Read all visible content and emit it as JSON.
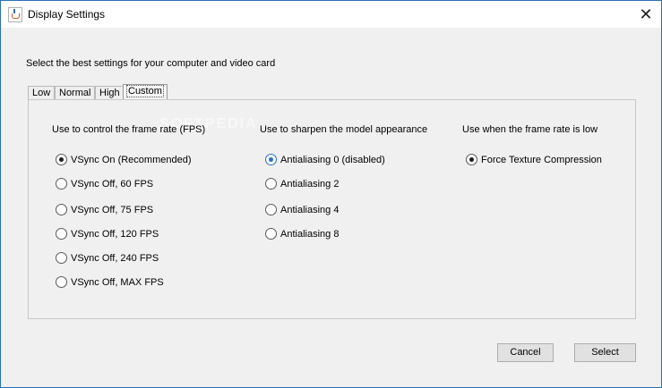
{
  "window": {
    "title": "Display Settings",
    "close_glyph": "✕"
  },
  "prompt": "Select the best settings for your computer and video card",
  "tabs": [
    {
      "label": "Low"
    },
    {
      "label": "Normal"
    },
    {
      "label": "High"
    },
    {
      "label": "Custom"
    }
  ],
  "watermark": "SOFTPEDIA",
  "columns": [
    {
      "header": "Use to control the frame rate (FPS)",
      "options": [
        {
          "label": "VSync On (Recommended)",
          "selected": true
        },
        {
          "label": "VSync Off, 60 FPS",
          "selected": false
        },
        {
          "label": "VSync Off, 75 FPS",
          "selected": false
        },
        {
          "label": "VSync Off, 120 FPS",
          "selected": false
        },
        {
          "label": "VSync Off, 240 FPS",
          "selected": false
        },
        {
          "label": "VSync Off, MAX FPS",
          "selected": false
        }
      ]
    },
    {
      "header": "Use to sharpen the model appearance",
      "options": [
        {
          "label": "Antialiasing 0 (disabled)",
          "selected": true
        },
        {
          "label": "Antialiasing 2",
          "selected": false
        },
        {
          "label": "Antialiasing 4",
          "selected": false
        },
        {
          "label": "Antialiasing 8",
          "selected": false
        }
      ]
    },
    {
      "header": "Use when the frame rate is low",
      "options": [
        {
          "label": "Force Texture Compression",
          "selected": true
        }
      ]
    }
  ],
  "buttons": {
    "cancel": "Cancel",
    "select": "Select"
  },
  "colors": {
    "focus_radio": "#2a6fc2",
    "window_border": "#2b6fb6"
  }
}
